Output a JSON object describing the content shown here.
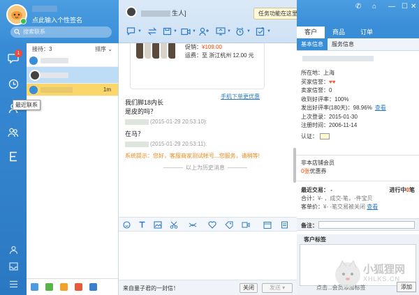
{
  "profile": {
    "signature": "点此输入个性签名",
    "search_placeholder": "搜索联系"
  },
  "sidebar": {
    "messages_badge": "1",
    "tooltip": "最近联系"
  },
  "contacts": {
    "header_left": "接待：3",
    "header_right": "排序 ⌄",
    "current_time": "1m"
  },
  "chat": {
    "peer_name_suffix": "生人]",
    "task_tip": "任务功能在这里哦",
    "product": {
      "price_label": "促销：",
      "price": "¥109.00",
      "shipping": "运费：至 浙江杭州 12.00 元",
      "mobile_link": "手机下单更优惠"
    },
    "messages": [
      {
        "text": "我们脚18内长"
      },
      {
        "text": "是皮的吗？"
      },
      {
        "meta": "(2015-01-29 20:53:10):"
      },
      {
        "text": "在马？"
      },
      {
        "meta": "(2015-01-29 20:53:11):"
      }
    ],
    "system_tip": "系统提示：您好，客服商家测试帐号...您服务，请稍等!",
    "history_label": "以上为历史消息",
    "footer_text": "来自量子君的一封信！",
    "close_label": "关闭",
    "send_label": "发送"
  },
  "right_panel": {
    "tabs": [
      "客户",
      "商品",
      "订单"
    ],
    "sub_tabs": [
      "基本信息",
      "服务信息"
    ],
    "info": {
      "location": "所在地：上海",
      "buyer_credit": "买家信誉：",
      "seller_credit": "卖家信誉：0",
      "good_rate": "收到好评率：100%",
      "sent_rate": "发出好评率(180天)：98.96%",
      "view": "查看",
      "last_login": "上次登录：2015-01-30",
      "register": "注册时间：2006-11-14",
      "cert": "认证："
    },
    "membership": {
      "line1": "非本店铺会员",
      "coupon_prefix": "0张",
      "coupon_suffix": "优惠券"
    },
    "trade": {
      "recent": "最近交易： -",
      "in_progress_prefix": "进行中",
      "in_progress_count": "0",
      "in_progress_suffix": "笔",
      "total": "合计：",
      "total_detail": "¥-  ，成交-笔，-件宝贝",
      "avg": "客单价：",
      "avg_detail": "¥-  -笔交易被关闭",
      "view": "查看"
    },
    "remark_label": "备注：",
    "tag_title": "客户标签",
    "tag_hint": "点击...会员添加标签",
    "tag_add": "添加"
  },
  "watermark": {
    "title": "小狐狸网",
    "sub": "XHLKS.CN"
  },
  "colors": {
    "primary": "#3a8ed8",
    "accent_orange": "#f04a3a",
    "selected_row": "#bdddf7",
    "current_row": "#fbd76b"
  }
}
